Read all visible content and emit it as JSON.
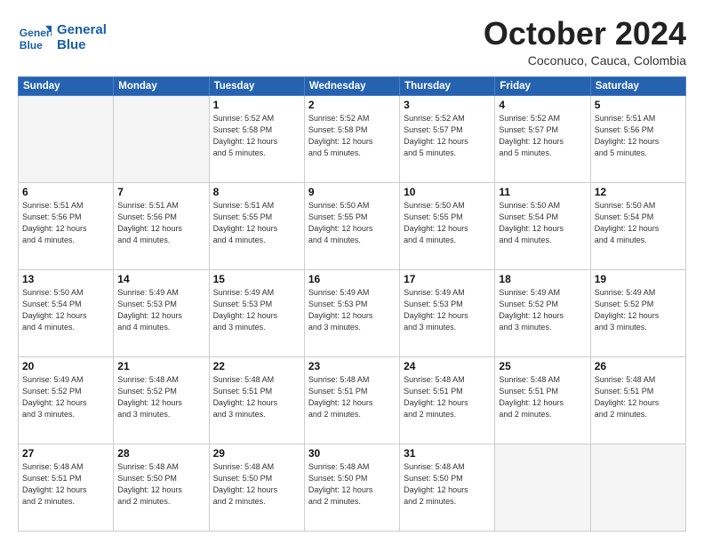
{
  "logo": {
    "line1": "General",
    "line2": "Blue"
  },
  "title": "October 2024",
  "subtitle": "Coconuco, Cauca, Colombia",
  "days_of_week": [
    "Sunday",
    "Monday",
    "Tuesday",
    "Wednesday",
    "Thursday",
    "Friday",
    "Saturday"
  ],
  "weeks": [
    [
      {
        "day": "",
        "info": ""
      },
      {
        "day": "",
        "info": ""
      },
      {
        "day": "1",
        "info": "Sunrise: 5:52 AM\nSunset: 5:58 PM\nDaylight: 12 hours\nand 5 minutes."
      },
      {
        "day": "2",
        "info": "Sunrise: 5:52 AM\nSunset: 5:58 PM\nDaylight: 12 hours\nand 5 minutes."
      },
      {
        "day": "3",
        "info": "Sunrise: 5:52 AM\nSunset: 5:57 PM\nDaylight: 12 hours\nand 5 minutes."
      },
      {
        "day": "4",
        "info": "Sunrise: 5:52 AM\nSunset: 5:57 PM\nDaylight: 12 hours\nand 5 minutes."
      },
      {
        "day": "5",
        "info": "Sunrise: 5:51 AM\nSunset: 5:56 PM\nDaylight: 12 hours\nand 5 minutes."
      }
    ],
    [
      {
        "day": "6",
        "info": "Sunrise: 5:51 AM\nSunset: 5:56 PM\nDaylight: 12 hours\nand 4 minutes."
      },
      {
        "day": "7",
        "info": "Sunrise: 5:51 AM\nSunset: 5:56 PM\nDaylight: 12 hours\nand 4 minutes."
      },
      {
        "day": "8",
        "info": "Sunrise: 5:51 AM\nSunset: 5:55 PM\nDaylight: 12 hours\nand 4 minutes."
      },
      {
        "day": "9",
        "info": "Sunrise: 5:50 AM\nSunset: 5:55 PM\nDaylight: 12 hours\nand 4 minutes."
      },
      {
        "day": "10",
        "info": "Sunrise: 5:50 AM\nSunset: 5:55 PM\nDaylight: 12 hours\nand 4 minutes."
      },
      {
        "day": "11",
        "info": "Sunrise: 5:50 AM\nSunset: 5:54 PM\nDaylight: 12 hours\nand 4 minutes."
      },
      {
        "day": "12",
        "info": "Sunrise: 5:50 AM\nSunset: 5:54 PM\nDaylight: 12 hours\nand 4 minutes."
      }
    ],
    [
      {
        "day": "13",
        "info": "Sunrise: 5:50 AM\nSunset: 5:54 PM\nDaylight: 12 hours\nand 4 minutes."
      },
      {
        "day": "14",
        "info": "Sunrise: 5:49 AM\nSunset: 5:53 PM\nDaylight: 12 hours\nand 4 minutes."
      },
      {
        "day": "15",
        "info": "Sunrise: 5:49 AM\nSunset: 5:53 PM\nDaylight: 12 hours\nand 3 minutes."
      },
      {
        "day": "16",
        "info": "Sunrise: 5:49 AM\nSunset: 5:53 PM\nDaylight: 12 hours\nand 3 minutes."
      },
      {
        "day": "17",
        "info": "Sunrise: 5:49 AM\nSunset: 5:53 PM\nDaylight: 12 hours\nand 3 minutes."
      },
      {
        "day": "18",
        "info": "Sunrise: 5:49 AM\nSunset: 5:52 PM\nDaylight: 12 hours\nand 3 minutes."
      },
      {
        "day": "19",
        "info": "Sunrise: 5:49 AM\nSunset: 5:52 PM\nDaylight: 12 hours\nand 3 minutes."
      }
    ],
    [
      {
        "day": "20",
        "info": "Sunrise: 5:49 AM\nSunset: 5:52 PM\nDaylight: 12 hours\nand 3 minutes."
      },
      {
        "day": "21",
        "info": "Sunrise: 5:48 AM\nSunset: 5:52 PM\nDaylight: 12 hours\nand 3 minutes."
      },
      {
        "day": "22",
        "info": "Sunrise: 5:48 AM\nSunset: 5:51 PM\nDaylight: 12 hours\nand 3 minutes."
      },
      {
        "day": "23",
        "info": "Sunrise: 5:48 AM\nSunset: 5:51 PM\nDaylight: 12 hours\nand 2 minutes."
      },
      {
        "day": "24",
        "info": "Sunrise: 5:48 AM\nSunset: 5:51 PM\nDaylight: 12 hours\nand 2 minutes."
      },
      {
        "day": "25",
        "info": "Sunrise: 5:48 AM\nSunset: 5:51 PM\nDaylight: 12 hours\nand 2 minutes."
      },
      {
        "day": "26",
        "info": "Sunrise: 5:48 AM\nSunset: 5:51 PM\nDaylight: 12 hours\nand 2 minutes."
      }
    ],
    [
      {
        "day": "27",
        "info": "Sunrise: 5:48 AM\nSunset: 5:51 PM\nDaylight: 12 hours\nand 2 minutes."
      },
      {
        "day": "28",
        "info": "Sunrise: 5:48 AM\nSunset: 5:50 PM\nDaylight: 12 hours\nand 2 minutes."
      },
      {
        "day": "29",
        "info": "Sunrise: 5:48 AM\nSunset: 5:50 PM\nDaylight: 12 hours\nand 2 minutes."
      },
      {
        "day": "30",
        "info": "Sunrise: 5:48 AM\nSunset: 5:50 PM\nDaylight: 12 hours\nand 2 minutes."
      },
      {
        "day": "31",
        "info": "Sunrise: 5:48 AM\nSunset: 5:50 PM\nDaylight: 12 hours\nand 2 minutes."
      },
      {
        "day": "",
        "info": ""
      },
      {
        "day": "",
        "info": ""
      }
    ]
  ]
}
